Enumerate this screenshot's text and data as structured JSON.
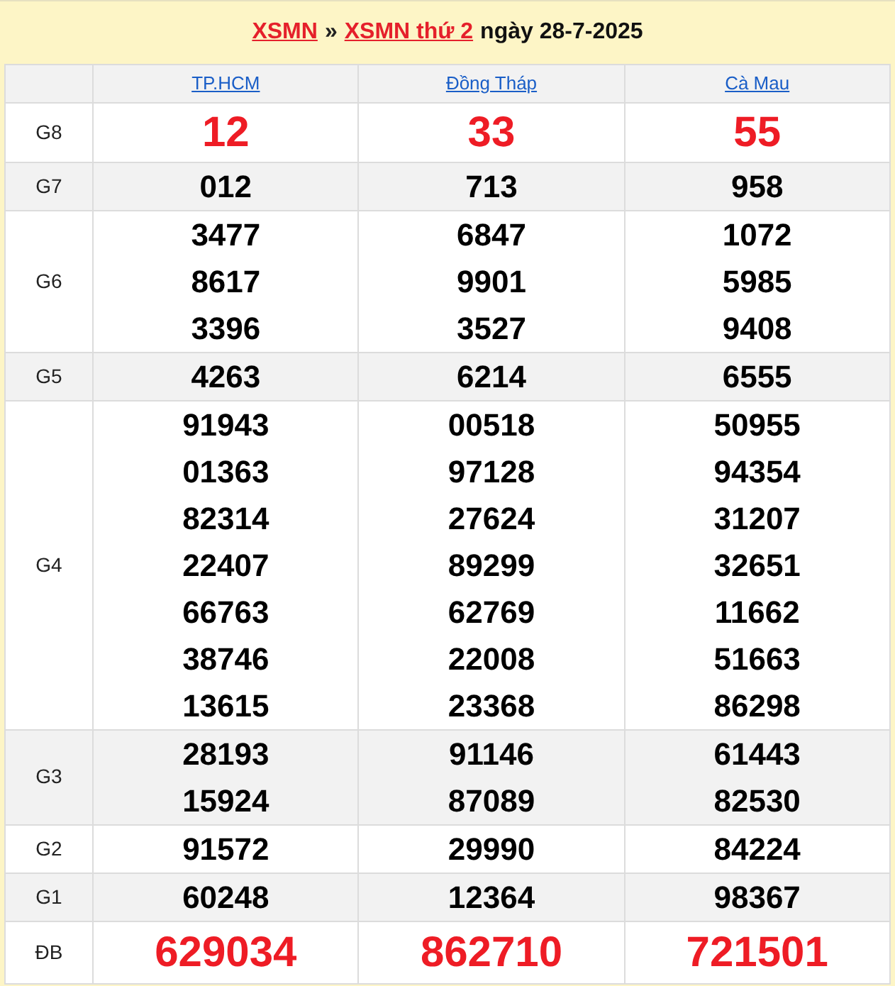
{
  "header": {
    "links": [
      "XSMN",
      "XSMN thứ 2"
    ],
    "separator": "»",
    "date_text": "ngày 28-7-2025"
  },
  "provinces": [
    "TP.HCM",
    "Đồng Tháp",
    "Cà Mau"
  ],
  "rows": [
    {
      "label": "G8",
      "kind": "highlight",
      "cells": [
        [
          "12"
        ],
        [
          "33"
        ],
        [
          "55"
        ]
      ]
    },
    {
      "label": "G7",
      "kind": "normal",
      "cells": [
        [
          "012"
        ],
        [
          "713"
        ],
        [
          "958"
        ]
      ]
    },
    {
      "label": "G6",
      "kind": "normal",
      "cells": [
        [
          "3477",
          "8617",
          "3396"
        ],
        [
          "6847",
          "9901",
          "3527"
        ],
        [
          "1072",
          "5985",
          "9408"
        ]
      ]
    },
    {
      "label": "G5",
      "kind": "normal",
      "cells": [
        [
          "4263"
        ],
        [
          "6214"
        ],
        [
          "6555"
        ]
      ]
    },
    {
      "label": "G4",
      "kind": "normal",
      "cells": [
        [
          "91943",
          "01363",
          "82314",
          "22407",
          "66763",
          "38746",
          "13615"
        ],
        [
          "00518",
          "97128",
          "27624",
          "89299",
          "62769",
          "22008",
          "23368"
        ],
        [
          "50955",
          "94354",
          "31207",
          "32651",
          "11662",
          "51663",
          "86298"
        ]
      ]
    },
    {
      "label": "G3",
      "kind": "normal",
      "cells": [
        [
          "28193",
          "15924"
        ],
        [
          "91146",
          "87089"
        ],
        [
          "61443",
          "82530"
        ]
      ]
    },
    {
      "label": "G2",
      "kind": "normal",
      "cells": [
        [
          "91572"
        ],
        [
          "29990"
        ],
        [
          "84224"
        ]
      ]
    },
    {
      "label": "G1",
      "kind": "normal",
      "cells": [
        [
          "60248"
        ],
        [
          "12364"
        ],
        [
          "98367"
        ]
      ]
    },
    {
      "label": "ĐB",
      "kind": "highlight",
      "cells": [
        [
          "629034"
        ],
        [
          "862710"
        ],
        [
          "721501"
        ]
      ]
    }
  ]
}
